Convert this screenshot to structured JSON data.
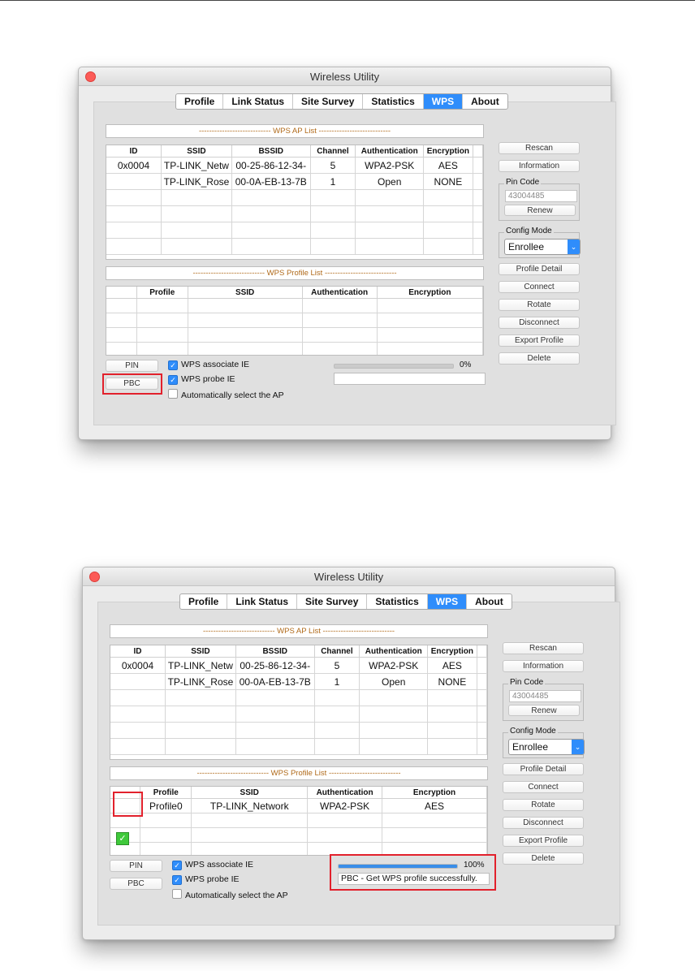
{
  "windows": [
    {
      "title": "Wireless Utility",
      "tabs": [
        "Profile",
        "Link Status",
        "Site Survey",
        "Statistics",
        "WPS",
        "About"
      ],
      "active_tab": "WPS",
      "ap_list_header": "---------------------------- WPS AP List ----------------------------",
      "ap_columns": [
        "ID",
        "SSID",
        "BSSID",
        "Channel",
        "Authentication",
        "Encryption"
      ],
      "ap_rows": [
        [
          "0x0004",
          "TP-LINK_Netw",
          "00-25-86-12-34-",
          "5",
          "WPA2-PSK",
          "AES"
        ],
        [
          "",
          "TP-LINK_Rose",
          "00-0A-EB-13-7B",
          "1",
          "Open",
          "NONE"
        ]
      ],
      "profile_list_header": "---------------------------- WPS Profile List ----------------------------",
      "profile_columns": [
        "",
        "Profile",
        "SSID",
        "Authentication",
        "Encryption"
      ],
      "profile_rows": [],
      "side_buttons": {
        "rescan": "Rescan",
        "information": "Information",
        "profile_detail": "Profile Detail",
        "connect": "Connect",
        "rotate": "Rotate",
        "disconnect": "Disconnect",
        "export_profile": "Export Profile",
        "delete": "Delete"
      },
      "pin_code_label": "Pin Code",
      "pin_code_value": "43004485",
      "renew_label": "Renew",
      "config_mode_label": "Config Mode",
      "config_mode_value": "Enrollee",
      "pin_button": "PIN",
      "pbc_button": "PBC",
      "checkboxes": [
        {
          "label": "WPS associate IE",
          "checked": true
        },
        {
          "label": "WPS probe IE",
          "checked": true
        },
        {
          "label": "Automatically select the AP",
          "checked": false
        }
      ],
      "progress": 0,
      "progress_text": "0%",
      "status_text": ""
    },
    {
      "title": "Wireless Utility",
      "tabs": [
        "Profile",
        "Link Status",
        "Site Survey",
        "Statistics",
        "WPS",
        "About"
      ],
      "active_tab": "WPS",
      "ap_list_header": "---------------------------- WPS AP List ----------------------------",
      "ap_columns": [
        "ID",
        "SSID",
        "BSSID",
        "Channel",
        "Authentication",
        "Encryption"
      ],
      "ap_rows": [
        [
          "0x0004",
          "TP-LINK_Netw",
          "00-25-86-12-34-",
          "5",
          "WPA2-PSK",
          "AES"
        ],
        [
          "",
          "TP-LINK_Rose",
          "00-0A-EB-13-7B",
          "1",
          "Open",
          "NONE"
        ]
      ],
      "profile_list_header": "---------------------------- WPS Profile List ----------------------------",
      "profile_columns": [
        "",
        "Profile",
        "SSID",
        "Authentication",
        "Encryption"
      ],
      "profile_rows": [
        [
          "",
          "Profile0",
          "TP-LINK_Network",
          "WPA2-PSK",
          "AES"
        ]
      ],
      "side_buttons": {
        "rescan": "Rescan",
        "information": "Information",
        "profile_detail": "Profile Detail",
        "connect": "Connect",
        "rotate": "Rotate",
        "disconnect": "Disconnect",
        "export_profile": "Export Profile",
        "delete": "Delete"
      },
      "pin_code_label": "Pin Code",
      "pin_code_value": "43004485",
      "renew_label": "Renew",
      "config_mode_label": "Config Mode",
      "config_mode_value": "Enrollee",
      "pin_button": "PIN",
      "pbc_button": "PBC",
      "checkboxes": [
        {
          "label": "WPS associate IE",
          "checked": true
        },
        {
          "label": "WPS probe IE",
          "checked": true
        },
        {
          "label": "Automatically select the AP",
          "checked": false
        }
      ],
      "progress": 1,
      "progress_text": "100%",
      "status_text": "PBC - Get WPS profile successfully."
    }
  ],
  "colors": {
    "accent": "#2f8dfb",
    "highlight": "#e2212c",
    "header_text": "#b06a1a",
    "check_green": "#3fc93b"
  }
}
